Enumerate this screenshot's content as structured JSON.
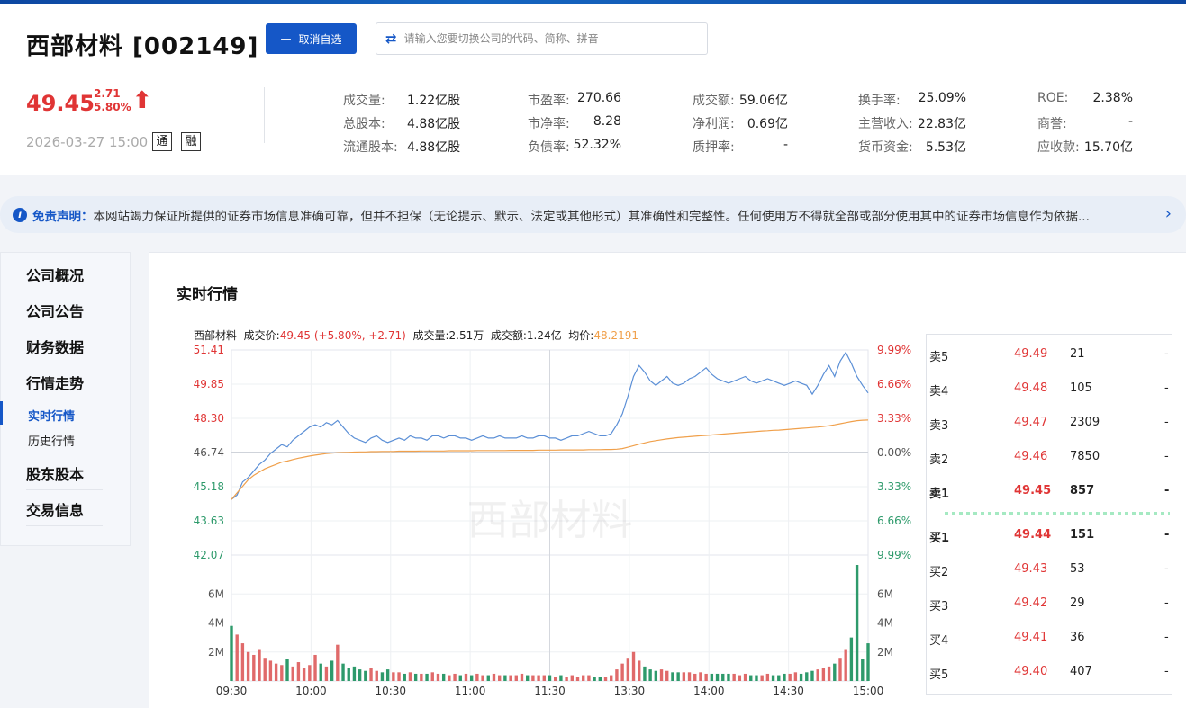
{
  "header": {
    "title": "西部材料 [002149]",
    "fav_button": "取消自选",
    "search_placeholder": "请输入您要切换公司的代码、简称、拼音"
  },
  "quote": {
    "price": "49.45",
    "change": "2.71",
    "change_pct": "5.80%",
    "datetime": "2026-03-27 15:00",
    "tag1": "通",
    "tag2": "融"
  },
  "stats": [
    {
      "label": "成交量:",
      "value": "1.22亿股"
    },
    {
      "label": "总股本:",
      "value": "4.88亿股"
    },
    {
      "label": "流通股本:",
      "value": "4.88亿股"
    },
    {
      "label": "市盈率:",
      "value": "270.66"
    },
    {
      "label": "市净率:",
      "value": "8.28"
    },
    {
      "label": "负债率:",
      "value": "52.32%"
    },
    {
      "label": "成交额:",
      "value": "59.06亿"
    },
    {
      "label": "净利润:",
      "value": "0.69亿"
    },
    {
      "label": "质押率:",
      "value": "-"
    },
    {
      "label": "换手率:",
      "value": "25.09%"
    },
    {
      "label": "主营收入:",
      "value": "22.83亿"
    },
    {
      "label": "货币资金:",
      "value": "5.53亿"
    },
    {
      "label": "ROE:",
      "value": "2.38%"
    },
    {
      "label": "商誉:",
      "value": "-"
    },
    {
      "label": "应收款:",
      "value": "15.70亿"
    }
  ],
  "notice": {
    "title": "免责声明：",
    "text": "本网站竭力保证所提供的证券市场信息准确可靠，但并不担保（无论提示、默示、法定或其他形式）其准确性和完整性。任何使用方不得就全部或部分使用其中的证券市场信息作为依据..."
  },
  "sidebar": {
    "items": [
      "公司概况",
      "公司公告",
      "财务数据",
      "行情走势",
      "股东股本",
      "交易信息"
    ],
    "sub_items": [
      "实时行情",
      "历史行情"
    ]
  },
  "section_title": "实时行情",
  "chart_header": {
    "name": "西部材料",
    "price_label": "成交价:",
    "price_value": "49.45 (+5.80%, +2.71)",
    "vol_label": "成交量:",
    "vol_value": "2.51万",
    "amt_label": "成交额:",
    "amt_value": "1.24亿",
    "avg_label": "均价:",
    "avg_value": "48.2191"
  },
  "chart_data": {
    "type": "line",
    "watermark": "西部材料",
    "y_left_ticks": [
      "51.41",
      "49.85",
      "48.30",
      "46.74",
      "45.18",
      "43.63",
      "42.07"
    ],
    "y_right_ticks": [
      "9.99%",
      "6.66%",
      "3.33%",
      "0.00%",
      "3.33%",
      "6.66%",
      "9.99%"
    ],
    "vol_ticks": [
      "6M",
      "4M",
      "2M"
    ],
    "x_ticks": [
      "09:30",
      "10:00",
      "10:30",
      "11:00",
      "11:30",
      "13:30",
      "14:00",
      "14:30",
      "15:00"
    ],
    "ylim": [
      42.07,
      51.41
    ],
    "prev_close": 46.74,
    "vol_max": 8000000,
    "series": [
      {
        "name": "成交价",
        "color": "#5b8fd6",
        "values": [
          44.6,
          44.8,
          45.4,
          45.6,
          45.9,
          46.2,
          46.4,
          46.7,
          46.9,
          47.1,
          47.0,
          47.3,
          47.5,
          47.7,
          47.9,
          48.0,
          47.9,
          48.1,
          48.0,
          48.2,
          47.9,
          47.6,
          47.4,
          47.3,
          47.2,
          47.4,
          47.5,
          47.3,
          47.2,
          47.3,
          47.4,
          47.3,
          47.5,
          47.4,
          47.4,
          47.3,
          47.5,
          47.5,
          47.4,
          47.5,
          47.5,
          47.4,
          47.4,
          47.3,
          47.4,
          47.5,
          47.4,
          47.4,
          47.5,
          47.4,
          47.4,
          47.4,
          47.5,
          47.4,
          47.4,
          47.5,
          47.5,
          47.4,
          47.4,
          47.3,
          47.4,
          47.5,
          47.5,
          47.6,
          47.7,
          47.6,
          47.5,
          47.5,
          47.6,
          48.0,
          48.5,
          49.3,
          50.2,
          50.7,
          50.4,
          50.0,
          49.8,
          50.0,
          50.2,
          49.9,
          49.8,
          49.9,
          50.1,
          50.2,
          50.4,
          50.6,
          50.3,
          50.1,
          50.0,
          49.9,
          50.0,
          50.1,
          50.2,
          50.0,
          49.9,
          50.0,
          50.1,
          50.0,
          49.9,
          49.8,
          49.9,
          50.0,
          49.9,
          49.8,
          49.4,
          49.8,
          50.3,
          50.7,
          50.2,
          50.9,
          51.3,
          50.8,
          50.2,
          49.8,
          49.45
        ]
      },
      {
        "name": "均价",
        "color": "#f0a04b",
        "values": [
          44.6,
          44.9,
          45.2,
          45.5,
          45.7,
          45.85,
          46.0,
          46.1,
          46.2,
          46.3,
          46.35,
          46.42,
          46.48,
          46.53,
          46.58,
          46.62,
          46.66,
          46.69,
          46.71,
          46.73,
          46.74,
          46.75,
          46.76,
          46.77,
          46.77,
          46.78,
          46.78,
          46.79,
          46.79,
          46.79,
          46.8,
          46.8,
          46.8,
          46.8,
          46.81,
          46.81,
          46.81,
          46.81,
          46.81,
          46.82,
          46.82,
          46.82,
          46.82,
          46.82,
          46.83,
          46.83,
          46.83,
          46.83,
          46.83,
          46.83,
          46.84,
          46.84,
          46.84,
          46.84,
          46.84,
          46.85,
          46.85,
          46.85,
          46.85,
          46.86,
          46.86,
          46.86,
          46.86,
          46.86,
          46.87,
          46.87,
          46.87,
          46.88,
          46.88,
          46.89,
          46.92,
          46.98,
          47.05,
          47.12,
          47.18,
          47.24,
          47.28,
          47.32,
          47.36,
          47.39,
          47.42,
          47.44,
          47.46,
          47.48,
          47.5,
          47.52,
          47.54,
          47.56,
          47.58,
          47.6,
          47.62,
          47.64,
          47.66,
          47.68,
          47.7,
          47.72,
          47.73,
          47.75,
          47.76,
          47.78,
          47.8,
          47.82,
          47.84,
          47.86,
          47.88,
          47.9,
          47.93,
          47.96,
          48.0,
          48.05,
          48.1,
          48.15,
          48.19,
          48.21,
          48.22
        ]
      }
    ],
    "volumes": [
      3.8,
      3.2,
      2.6,
      2.0,
      1.8,
      2.2,
      1.6,
      1.4,
      1.2,
      1.1,
      1.5,
      1.0,
      1.3,
      0.9,
      1.1,
      1.8,
      1.2,
      1.0,
      1.4,
      2.5,
      1.2,
      0.9,
      1.0,
      0.8,
      0.7,
      0.9,
      0.7,
      0.6,
      0.8,
      0.6,
      0.6,
      0.5,
      0.6,
      0.5,
      0.5,
      0.5,
      0.6,
      0.5,
      0.5,
      0.4,
      0.5,
      0.4,
      0.5,
      0.4,
      0.5,
      0.4,
      0.4,
      0.5,
      0.4,
      0.4,
      0.4,
      0.4,
      0.5,
      0.4,
      0.4,
      0.4,
      0.4,
      0.4,
      0.3,
      0.4,
      0.3,
      0.4,
      0.3,
      0.4,
      0.4,
      0.3,
      0.3,
      0.3,
      0.4,
      0.8,
      1.2,
      1.6,
      2.0,
      1.4,
      1.0,
      0.8,
      0.7,
      0.8,
      0.7,
      0.6,
      0.6,
      0.6,
      0.6,
      0.5,
      0.6,
      0.5,
      0.5,
      0.5,
      0.5,
      0.5,
      0.5,
      0.4,
      0.5,
      0.4,
      0.4,
      0.4,
      0.5,
      0.4,
      0.4,
      0.5,
      0.5,
      0.6,
      0.5,
      0.6,
      0.7,
      0.8,
      0.9,
      1.0,
      1.2,
      1.6,
      2.2,
      3.0,
      8.0,
      1.5,
      2.6
    ],
    "up_color": "#e06a6a",
    "down_color": "#2e9a6b"
  },
  "order_book": {
    "asks": [
      {
        "label": "卖5",
        "price": "49.49",
        "vol": "21",
        "extra": "-"
      },
      {
        "label": "卖4",
        "price": "49.48",
        "vol": "105",
        "extra": "-"
      },
      {
        "label": "卖3",
        "price": "49.47",
        "vol": "2309",
        "extra": "-"
      },
      {
        "label": "卖2",
        "price": "49.46",
        "vol": "7850",
        "extra": "-"
      },
      {
        "label": "卖1",
        "price": "49.45",
        "vol": "857",
        "extra": "-"
      }
    ],
    "bids": [
      {
        "label": "买1",
        "price": "49.44",
        "vol": "151",
        "extra": "-"
      },
      {
        "label": "买2",
        "price": "49.43",
        "vol": "53",
        "extra": "-"
      },
      {
        "label": "买3",
        "price": "49.42",
        "vol": "29",
        "extra": "-"
      },
      {
        "label": "买4",
        "price": "49.41",
        "vol": "36",
        "extra": "-"
      },
      {
        "label": "买5",
        "price": "49.40",
        "vol": "407",
        "extra": "-"
      }
    ]
  }
}
